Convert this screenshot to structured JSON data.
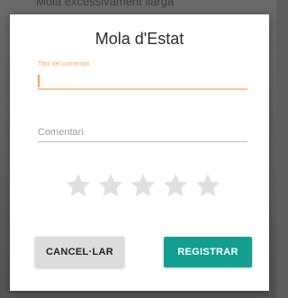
{
  "background": {
    "partial_text": "Mola excessivament llarga"
  },
  "dialog": {
    "title": "Mola d'Estat",
    "comment_title": {
      "label": "Títol del comentari",
      "value": ""
    },
    "comment": {
      "placeholder": "Comentari",
      "value": ""
    },
    "rating": {
      "value": 0,
      "max": 5,
      "empty_star_color": "#e0e0e0"
    },
    "buttons": {
      "cancel": "CANCEL·LAR",
      "save": "REGISTRAR"
    }
  },
  "colors": {
    "accent_orange": "#ffa860",
    "primary_teal": "#129f8f",
    "scrim": "#5e5e5e"
  }
}
